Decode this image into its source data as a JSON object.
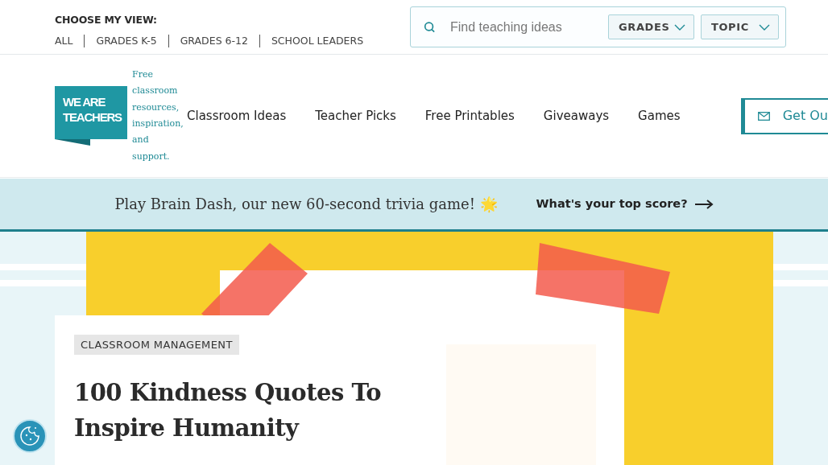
{
  "view_chooser": {
    "label": "CHOOSE MY VIEW:",
    "options": [
      "ALL",
      "GRADES K-5",
      "GRADES 6-12",
      "SCHOOL LEADERS"
    ]
  },
  "search": {
    "placeholder": "Find teaching ideas",
    "filters": [
      "GRADES",
      "TOPIC"
    ]
  },
  "logo": {
    "lines": [
      "WE ARE",
      "TEACHERS"
    ],
    "tagline": "Free classroom resources, inspiration, and support."
  },
  "nav": [
    "Classroom Ideas",
    "Teacher Picks",
    "Free Printables",
    "Giveaways",
    "Games"
  ],
  "newsletter_button": "Get Ou",
  "banner": {
    "text": "Play Brain Dash, our new 60-second trivia game! 🌟",
    "link": "What's your top score?"
  },
  "article": {
    "category": "CLASSROOM MANAGEMENT",
    "title": "100 Kindness Quotes To Inspire Humanity"
  }
}
